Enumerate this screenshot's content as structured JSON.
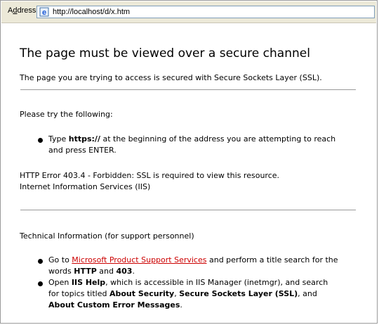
{
  "addressbar": {
    "label": "Address",
    "url": "http://localhost/d/x.htm"
  },
  "page": {
    "title": "The page must be viewed over a secure channel",
    "intro": "The page you are trying to access is secured with Secure Sockets Layer (SSL).",
    "try_heading": "Please try the following:",
    "try_bullet": {
      "pre": "Type ",
      "bold": "https://",
      "post1": " at the beginning of the address you are attempting to reach",
      "post2": "and press ENTER."
    },
    "error_line": "HTTP Error 403.4 - Forbidden: SSL is required to view this resource.",
    "server_line": "Internet Information Services (IIS)",
    "tech_heading": "Technical Information (for support personnel)",
    "tech_bullet1": {
      "pre": "Go to ",
      "link": "Microsoft Product Support Services",
      "post": " and perform a title search for the",
      "line2_pre": "words ",
      "bold1": "HTTP",
      "mid": " and ",
      "bold2": "403",
      "end": "."
    },
    "tech_bullet2": {
      "pre": "Open ",
      "bold1": "IIS Help",
      "post": ", which is accessible in IIS Manager (inetmgr), and search",
      "line2_pre": "for topics titled ",
      "bold2": "About Security",
      "sep": ", ",
      "bold3": "Secure Sockets Layer (SSL)",
      "line2_end": ", and",
      "bold4": "About Custom Error Messages",
      "end": "."
    }
  },
  "colors": {
    "link": "#cc0000",
    "chrome": "#ece9d8"
  }
}
